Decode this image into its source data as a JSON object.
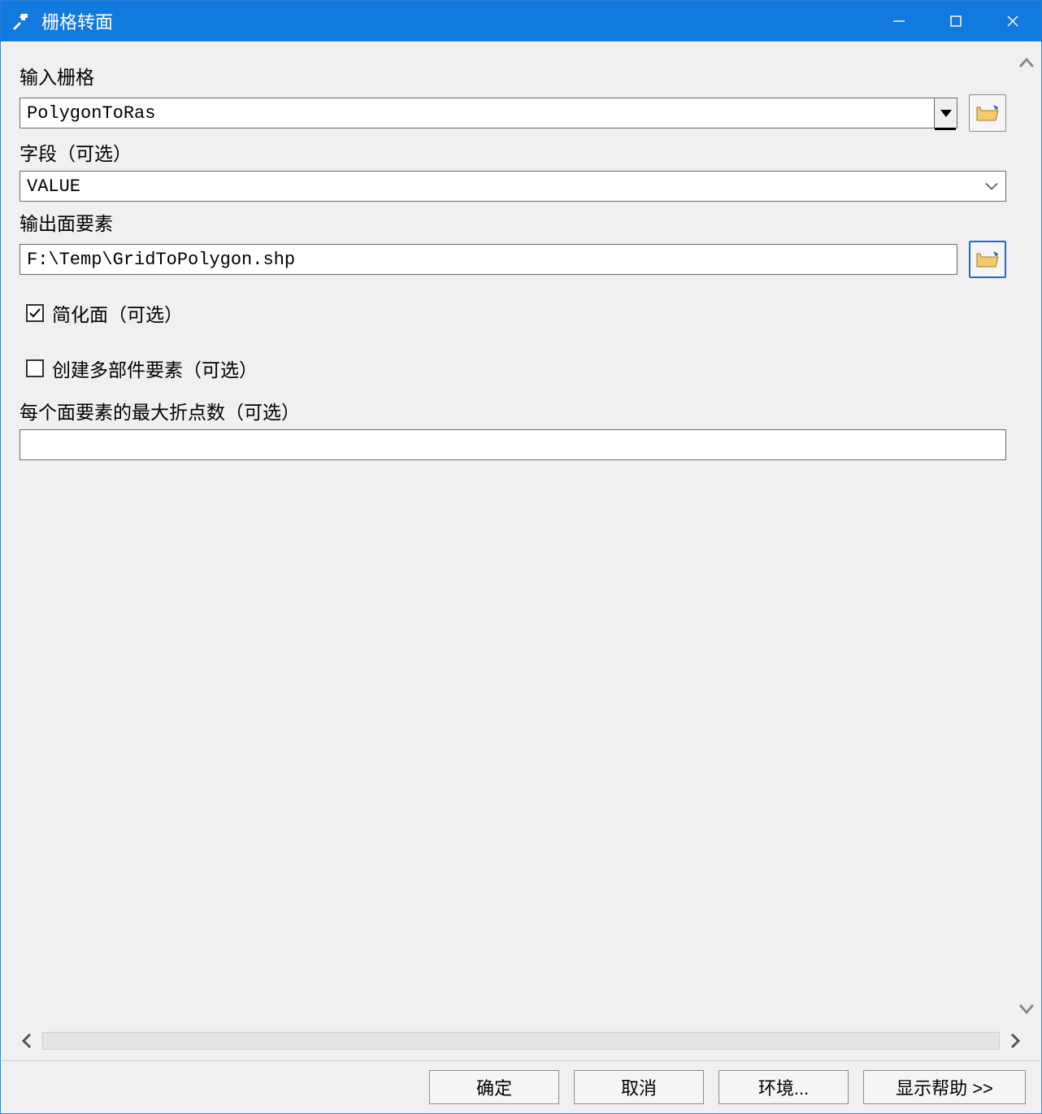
{
  "window": {
    "title": "栅格转面"
  },
  "form": {
    "input_raster": {
      "label": "输入栅格",
      "value": "PolygonToRas"
    },
    "field": {
      "label": "字段（可选）",
      "value": "VALUE"
    },
    "output_features": {
      "label": "输出面要素",
      "value": "F:\\Temp\\GridToPolygon.shp"
    },
    "simplify": {
      "label": "简化面（可选）",
      "checked": true
    },
    "multipart": {
      "label": "创建多部件要素（可选）",
      "checked": false
    },
    "max_vertices": {
      "label": "每个面要素的最大折点数（可选）",
      "value": ""
    }
  },
  "buttons": {
    "ok": "确定",
    "cancel": "取消",
    "environment": "环境...",
    "help": "显示帮助 >>"
  }
}
